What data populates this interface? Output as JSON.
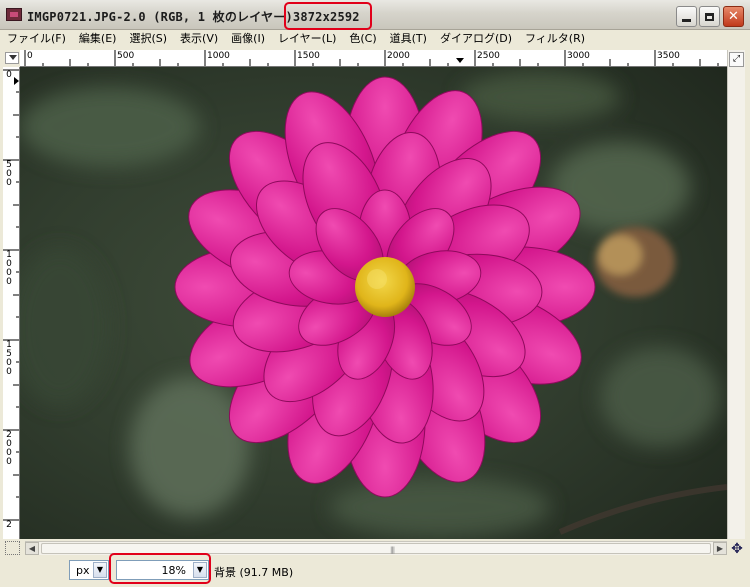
{
  "window": {
    "title": "IMGP0721.JPG-2.0 (RGB, 1 枚のレイヤー)",
    "dimensions": "3872x2592",
    "buttons": {
      "minimize": "minimize",
      "maximize": "maximize",
      "close": "close"
    }
  },
  "menu": [
    "ファイル(F)",
    "編集(E)",
    "選択(S)",
    "表示(V)",
    "画像(I)",
    "レイヤー(L)",
    "色(C)",
    "道具(T)",
    "ダイアログ(D)",
    "フィルタ(R)"
  ],
  "rulers": {
    "horizontal": [
      "0",
      "500",
      "1000",
      "1500",
      "2000",
      "2500",
      "3000",
      "3500"
    ],
    "vertical": [
      "0",
      "500",
      "1000",
      "1500",
      "2000",
      "2"
    ]
  },
  "canvas": {
    "image": "photo of a magenta dahlia flower with a yellow center on a blurred green background"
  },
  "statusbar": {
    "unit": "px",
    "zoom": "18%",
    "message": "背景 (91.7 MB)"
  },
  "colors": {
    "highlight": "#e1001a",
    "flower": "#d3168c",
    "flower_center": "#e8c21a",
    "background": "#33412f"
  }
}
